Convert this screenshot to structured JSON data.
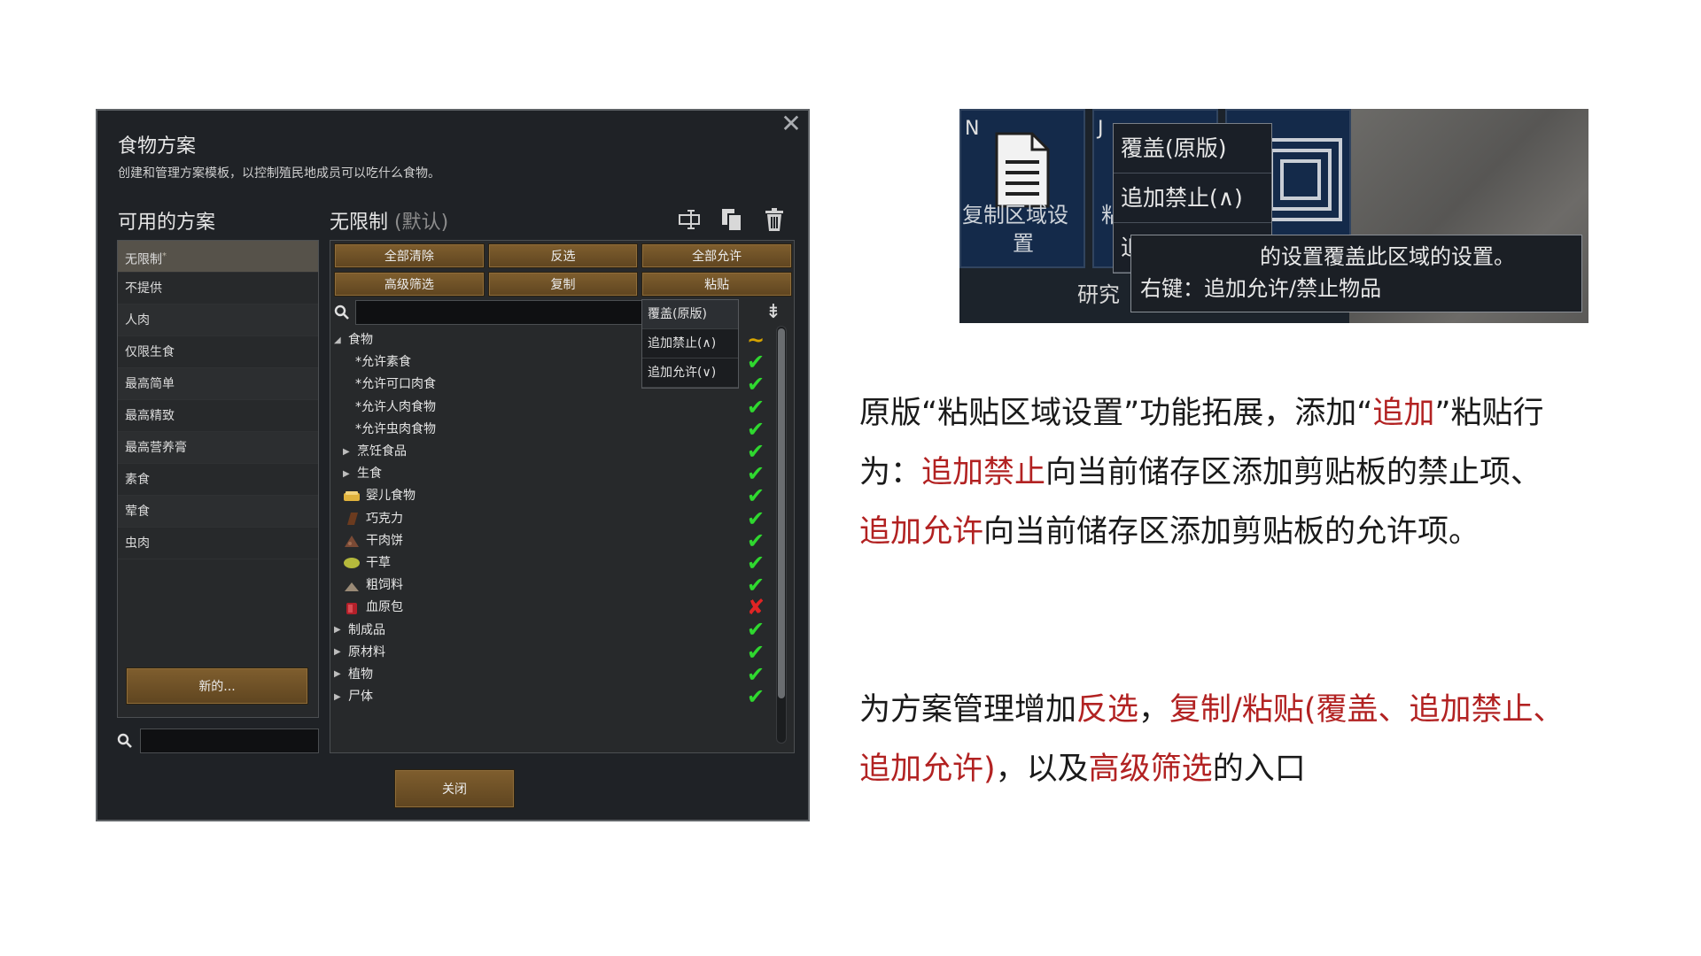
{
  "dialog": {
    "title": "食物方案",
    "description": "创建和管理方案模板，以控制殖民地成员可以吃什么食物。",
    "available_label": "可用的方案",
    "current_name": "无限制",
    "current_suffix": "(默认)",
    "plans": [
      "无限制",
      "不提供",
      "人肉",
      "仅限生食",
      "最高简单",
      "最高精致",
      "最高营养膏",
      "素食",
      "荤食",
      "虫肉"
    ],
    "active_plan_marker": "*",
    "new_button": "新的...",
    "buttons": [
      "全部清除",
      "反选",
      "全部允许",
      "高级筛选",
      "复制",
      "粘贴"
    ],
    "paste_menu": [
      "覆盖(原版)",
      "追加禁止(∧)",
      "追加允许(∨)"
    ],
    "tree": [
      {
        "label": "食物",
        "indent": 0,
        "arrow": "down",
        "mark": "partial"
      },
      {
        "label": "*允许素食",
        "indent": 1,
        "arrow": "",
        "mark": "ok"
      },
      {
        "label": "*允许可口肉食",
        "indent": 1,
        "arrow": "",
        "mark": "ok"
      },
      {
        "label": "*允许人肉食物",
        "indent": 1,
        "arrow": "",
        "mark": "ok"
      },
      {
        "label": "*允许虫肉食物",
        "indent": 1,
        "arrow": "",
        "mark": "ok"
      },
      {
        "label": "烹饪食品",
        "indent": 1,
        "arrow": "right",
        "mark": "ok"
      },
      {
        "label": "生食",
        "indent": 1,
        "arrow": "right",
        "mark": "ok"
      },
      {
        "label": "婴儿食物",
        "indent": 1,
        "arrow": "",
        "icon": "baby-food-icon",
        "mark": "ok"
      },
      {
        "label": "巧克力",
        "indent": 1,
        "arrow": "",
        "icon": "chocolate-icon",
        "mark": "ok"
      },
      {
        "label": "干肉饼",
        "indent": 1,
        "arrow": "",
        "icon": "pemmican-icon",
        "mark": "ok"
      },
      {
        "label": "干草",
        "indent": 1,
        "arrow": "",
        "icon": "hay-icon",
        "mark": "ok"
      },
      {
        "label": "粗饲料",
        "indent": 1,
        "arrow": "",
        "icon": "kibble-icon",
        "mark": "ok"
      },
      {
        "label": "血原包",
        "indent": 1,
        "arrow": "",
        "icon": "hemogen-pack-icon",
        "mark": "no"
      },
      {
        "label": "制成品",
        "indent": 0,
        "arrow": "right",
        "mark": "ok"
      },
      {
        "label": "原材料",
        "indent": 0,
        "arrow": "right",
        "mark": "ok"
      },
      {
        "label": "植物",
        "indent": 0,
        "arrow": "right",
        "mark": "ok"
      },
      {
        "label": "尸体",
        "indent": 0,
        "arrow": "right",
        "mark": "ok"
      }
    ],
    "close_button": "关闭"
  },
  "screenshot": {
    "tile_label_line1": "复制区域设",
    "tile_label_line2": "置",
    "letter_n": "N",
    "letter_j": "J",
    "fragment": "粘",
    "menu": [
      "覆盖(原版)",
      "追加禁止(∧)",
      "追加允许(∨)"
    ],
    "tooltip_line1": "的设置覆盖此区域的设置。",
    "tooltip_line2": "右键：追加允许/禁止物品",
    "research": "研究"
  },
  "description": {
    "p1_a": "原版“粘贴区域设置”功能拓展，添加“",
    "p1_b": "追加",
    "p1_c": "”粘贴行为：",
    "p1_d": "追加禁止",
    "p1_e": "向当前储存区添加剪贴板的禁止项、",
    "p1_f": "追加允许",
    "p1_g": "向当前储存区添加剪贴板的允许项。",
    "p2_a": "为方案管理增加",
    "p2_b": "反选",
    "p2_c": "，",
    "p2_d": "复制/粘贴(覆盖、追加禁止、追加允许)",
    "p2_e": "，以及",
    "p2_f": "高级筛选",
    "p2_g": "的入口"
  },
  "colors": {
    "highlight": "#b22222",
    "check": "#2fd82f",
    "cross": "#e02424",
    "button": "#7f5e2e"
  }
}
